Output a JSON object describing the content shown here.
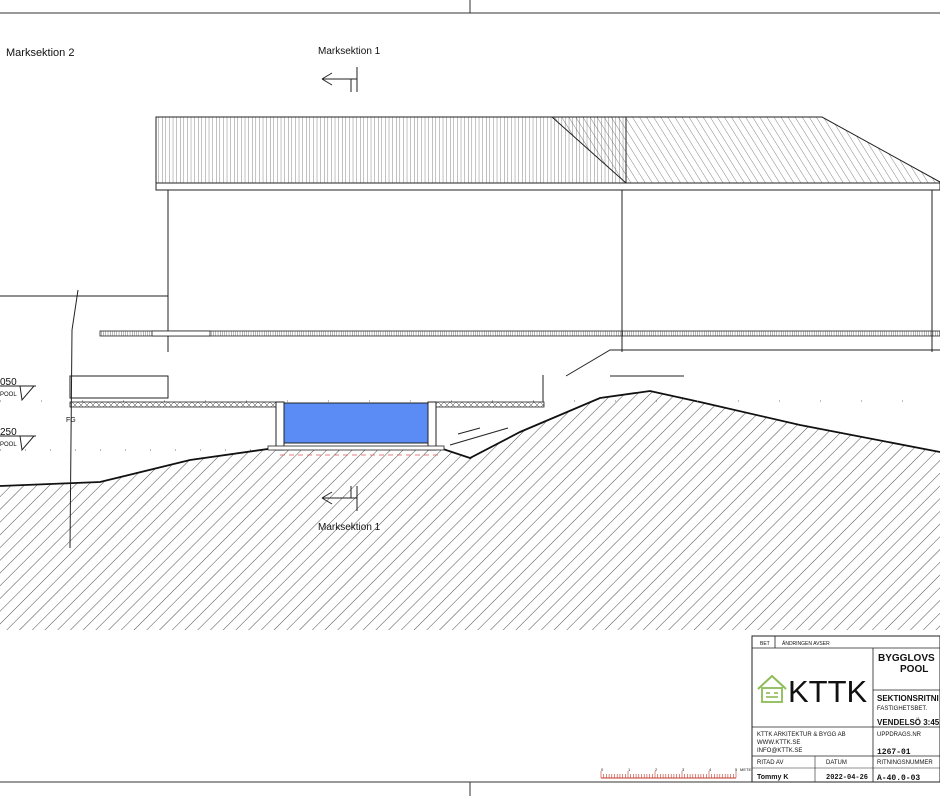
{
  "drawing": {
    "section_label_left": "Marksektion 2",
    "section_marker_top": "Marksektion 1",
    "section_marker_bottom": "Marksektion 1",
    "level_1": "050",
    "level_1_sub": "POOL",
    "level_2": "250",
    "level_2_sub": "POOL",
    "fg_label": "FG"
  },
  "title_block": {
    "bet_label": "BET",
    "change_label": "ÄNDRINGEN AVSER",
    "logo_text": "KTTK",
    "project_title_1": "BYGGLOVS",
    "project_title_2": "POOL",
    "drawing_type": "SEKTIONSRITNI",
    "property_label": "FASTIGHETSBET.",
    "property_value": "VENDELSÖ 3:45",
    "company_name": "KTTK ARKITEKTUR & BYGG AB",
    "company_web": "WWW.KTTK.SE",
    "company_email": "INFO@KTTK.SE",
    "order_label": "UPPDRAGS.NR",
    "order_value": "1267-01",
    "drawn_by_label": "RITAD AV",
    "date_label": "DATUM",
    "drawing_no_label": "RITNINGSNUMMER",
    "drawn_by_value": "Tommy K",
    "date_value": "2022-04-26",
    "drawing_no_value": "A-40.0-03"
  },
  "scale_bar": {
    "ticks": [
      "0",
      "1",
      "2",
      "3",
      "4",
      "5"
    ],
    "unit": "METER"
  },
  "colors": {
    "pool_water": "#5b8cf5",
    "logo_green": "#8dbb57",
    "line": "#1a1a1a",
    "scale_red": "#c0392b"
  }
}
